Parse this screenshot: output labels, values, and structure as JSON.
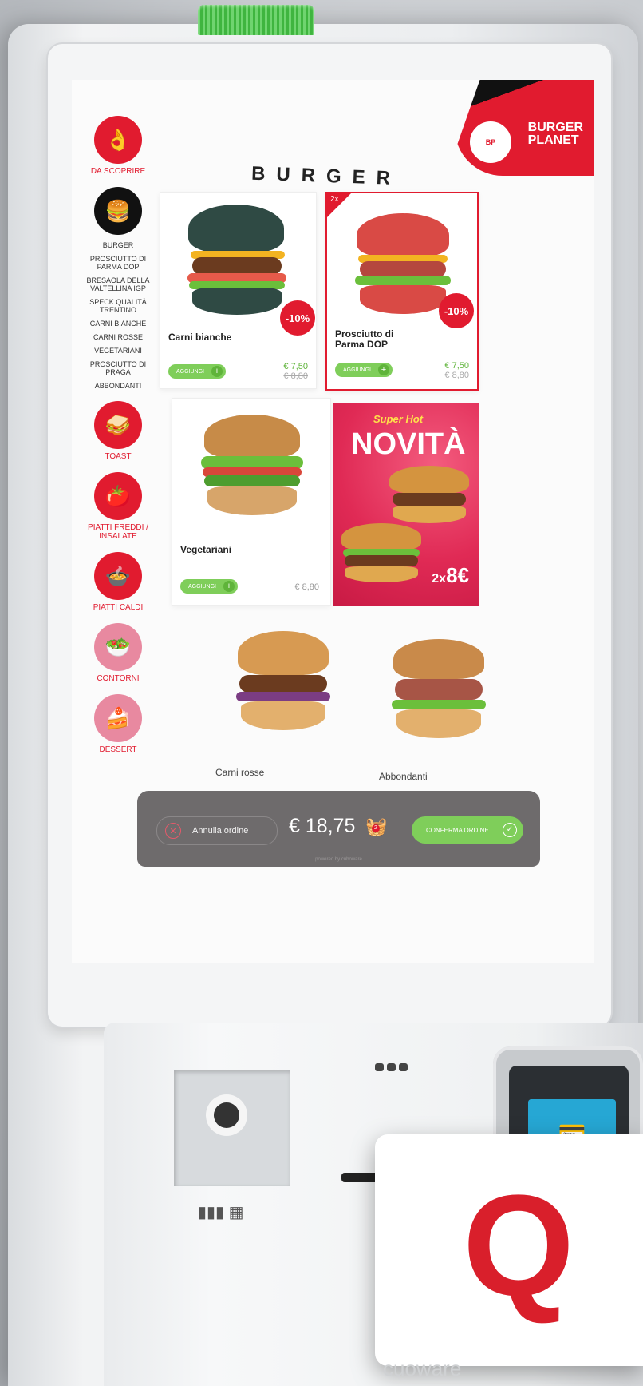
{
  "brand": {
    "name_line1": "BURGER",
    "name_line2": "PLANET"
  },
  "page_title": "BURGER",
  "sidebar": {
    "discover_label": "DA SCOPRIRE",
    "burger_sub_items": [
      "BURGER",
      "PROSCIUTTO DI PARMA DOP",
      "BRESAOLA DELLA VALTELLINA IGP",
      "SPECK QUALITÀ TRENTINO",
      "CARNI BIANCHE",
      "CARNI ROSSE",
      "VEGETARIANI",
      "PROSCIUTTO DI PRAGA",
      "ABBONDANTI"
    ],
    "categories": [
      "TOAST",
      "PIATTI FREDDI / INSALATE",
      "PIATTI CALDI",
      "CONTORNI",
      "DESSERT"
    ]
  },
  "products": [
    {
      "name": "Carni bianche",
      "discount": "-10%",
      "add_label": "AGGIUNGI",
      "price": "€ 7,50",
      "old_price": "€ 8,80"
    },
    {
      "name": "Prosciutto di Parma DOP",
      "badge": "2x",
      "discount": "-10%",
      "add_label": "AGGIUNGI",
      "price": "€ 7,50",
      "old_price": "€ 8,80"
    },
    {
      "name": "Vegetariani",
      "add_label": "AGGIUNGI",
      "price": "€ 8,80"
    }
  ],
  "promo": {
    "subtitle": "Super Hot",
    "title": "NOVITÀ",
    "price_prefix": "2x",
    "price_value": "8€"
  },
  "bottom_products": [
    "Carni rosse",
    "Abbondanti"
  ],
  "order_bar": {
    "cancel_label": "Annulla ordine",
    "total": "€ 18,75",
    "cart_count": "2",
    "confirm_label": "CONFERMA ORDINE",
    "powered_by": "powered by cuboware"
  },
  "hardware": {
    "footer_brand": "cuoware"
  },
  "colors": {
    "accent_red": "#e11b2f",
    "accent_green": "#7fce5a",
    "bar_gray": "#6e6b6c"
  }
}
